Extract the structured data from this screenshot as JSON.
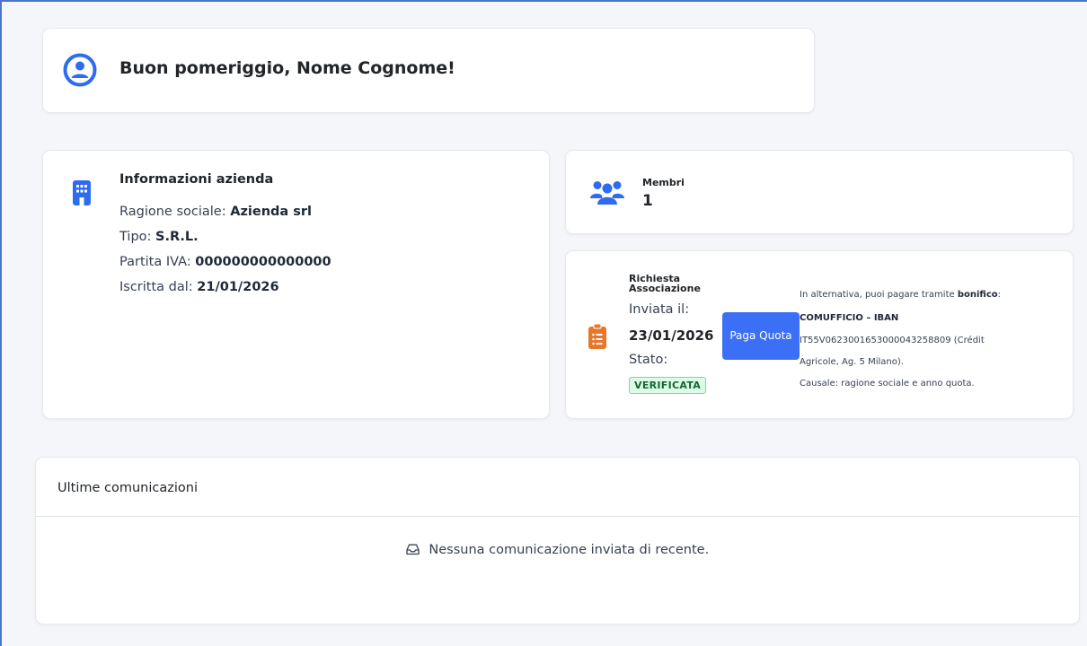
{
  "greeting": {
    "text": "Buon pomeriggio, Nome Cognome!",
    "icon": "user-circle-icon"
  },
  "company": {
    "heading": "Informazioni azienda",
    "icon": "building-icon",
    "ragione_label": "Ragione sociale:",
    "ragione_value": "Azienda srl",
    "tipo_label": "Tipo:",
    "tipo_value": "S.R.L.",
    "piva_label": "Partita IVA:",
    "piva_value": "000000000000000",
    "iscritta_label": "Iscritta dal:",
    "iscritta_value": "21/01/2026"
  },
  "members": {
    "label": "Membri",
    "count": "1",
    "icon": "users-icon"
  },
  "request": {
    "heading": "Richiesta Associazione",
    "icon": "clipboard-list-icon",
    "sent_label": "Inviata il:",
    "sent_value": "23/01/2026",
    "state_label": "Stato:",
    "state_value": "VERIFICATA",
    "pay_button": "Paga Quota",
    "note_line1_pre": "In alternativa, puoi pagare tramite",
    "note_line1_bold": "bonifico",
    "note_line1_post": ":",
    "note_line2": "COMUFFICIO – IBAN",
    "note_line3": "IT55V0623001653000043258809 (Crédit",
    "note_line4": "Agricole, Ag. 5 Milano).",
    "note_line5": "Causale: ragione sociale e anno quota."
  },
  "communications": {
    "heading": "Ultime comunicazioni",
    "empty_text": "Nessuna comunicazione inviata di recente.",
    "icon": "inbox-icon"
  },
  "colors": {
    "accent": "#3b6ff5",
    "icon_blue": "#2f6bf0",
    "icon_orange": "#e8762b",
    "badge_bg": "#dcfce7",
    "badge_text": "#166534"
  }
}
